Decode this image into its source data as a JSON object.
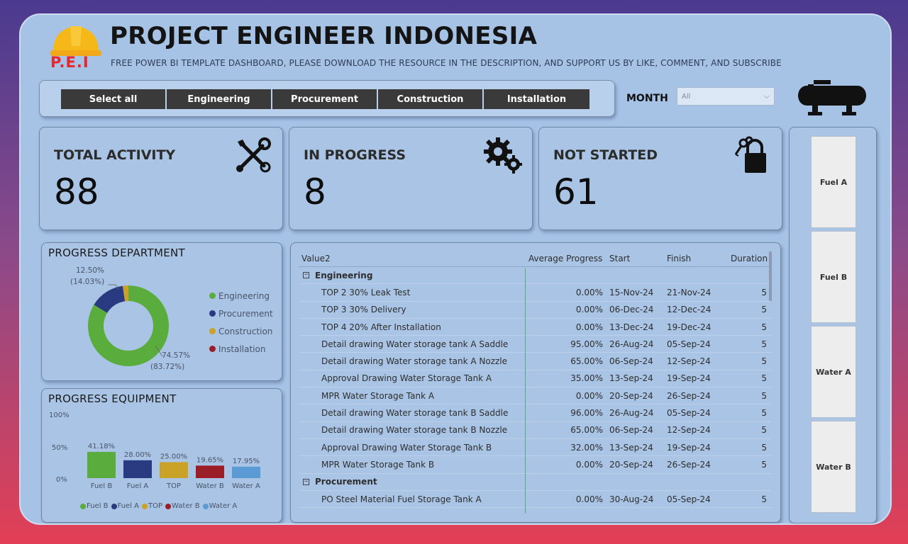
{
  "header": {
    "logo_text": "P.E.I",
    "title": "PROJECT ENGINEER INDONESIA",
    "subtitle": "FREE POWER BI TEMPLATE DASHBOARD, PLEASE DOWNLOAD THE RESOURCE IN THE DESCRIPTION, AND SUPPORT US BY LIKE, COMMENT, AND SUBSCRIBE"
  },
  "slicer": {
    "buttons": [
      "Select all",
      "Engineering",
      "Procurement",
      "Construction",
      "Installation"
    ]
  },
  "month": {
    "label": "MONTH",
    "selected": "All"
  },
  "kpis": [
    {
      "label": "TOTAL ACTIVITY",
      "value": "88",
      "icon": "tools-icon"
    },
    {
      "label": "IN PROGRESS",
      "value": "8",
      "icon": "gears-icon"
    },
    {
      "label": "NOT STARTED",
      "value": "61",
      "icon": "padlock-keys-icon"
    }
  ],
  "progress_department": {
    "title": "PROGRESS DEPARTMENT",
    "label_top_1": "12.50%",
    "label_top_2": "(14.03%)",
    "label_bottom_1": "74.57%",
    "label_bottom_2": "(83.72%)",
    "legend": [
      "Engineering",
      "Procurement",
      "Construction",
      "Installation"
    ]
  },
  "progress_equipment": {
    "title": "PROGRESS EQUIPMENT",
    "y_ticks": [
      "100%",
      "50%",
      "0%"
    ],
    "legend": [
      "Fuel B",
      "Fuel A",
      "TOP",
      "Water B",
      "Water A"
    ]
  },
  "table": {
    "headers": [
      "Value2",
      "Average Progress",
      "Start",
      "Finish",
      "Duration"
    ],
    "groups": [
      {
        "name": "Engineering",
        "rows": [
          [
            "TOP 2 30% Leak Test",
            "0.00%",
            "15-Nov-24",
            "21-Nov-24",
            "5"
          ],
          [
            "TOP 3 30% Delivery",
            "0.00%",
            "06-Dec-24",
            "12-Dec-24",
            "5"
          ],
          [
            "TOP 4 20% After Installation",
            "0.00%",
            "13-Dec-24",
            "19-Dec-24",
            "5"
          ],
          [
            "Detail drawing Water storage tank A Saddle",
            "95.00%",
            "26-Aug-24",
            "05-Sep-24",
            "5"
          ],
          [
            "Detail drawing Water storage tank A Nozzle",
            "65.00%",
            "06-Sep-24",
            "12-Sep-24",
            "5"
          ],
          [
            "Approval Drawing Water Storage Tank A",
            "35.00%",
            "13-Sep-24",
            "19-Sep-24",
            "5"
          ],
          [
            "MPR Water Storage Tank A",
            "0.00%",
            "20-Sep-24",
            "26-Sep-24",
            "5"
          ],
          [
            "Detail drawing Water storage tank B Saddle",
            "96.00%",
            "26-Aug-24",
            "05-Sep-24",
            "5"
          ],
          [
            "Detail drawing Water storage tank B Nozzle",
            "65.00%",
            "06-Sep-24",
            "12-Sep-24",
            "5"
          ],
          [
            "Approval Drawing Water Storage Tank B",
            "32.00%",
            "13-Sep-24",
            "19-Sep-24",
            "5"
          ],
          [
            "MPR Water Storage Tank B",
            "0.00%",
            "20-Sep-24",
            "26-Sep-24",
            "5"
          ]
        ]
      },
      {
        "name": "Procurement",
        "rows": [
          [
            "PO Steel Material Fuel Storage Tank A",
            "0.00%",
            "30-Aug-24",
            "05-Sep-24",
            "5"
          ]
        ]
      }
    ]
  },
  "tanks": [
    "Fuel A",
    "Fuel B",
    "Water A",
    "Water B"
  ],
  "colors": {
    "engineering": "#5aad3c",
    "procurement": "#2a3a80",
    "construction": "#c9a227",
    "installation": "#9b1d27",
    "water_a": "#5b9bd5"
  },
  "chart_data": [
    {
      "type": "pie",
      "title": "PROGRESS DEPARTMENT",
      "categories": [
        "Engineering",
        "Procurement",
        "Construction",
        "Installation"
      ],
      "values": [
        83.72,
        14.03,
        2.25,
        0
      ],
      "colors": [
        "#5aad3c",
        "#2a3a80",
        "#c9a227",
        "#9b1d27"
      ],
      "legend": "right"
    },
    {
      "type": "bar",
      "title": "PROGRESS EQUIPMENT",
      "categories": [
        "Fuel B",
        "Fuel A",
        "TOP",
        "Water B",
        "Water A"
      ],
      "values": [
        41.18,
        28.0,
        25.0,
        19.65,
        17.95
      ],
      "data_labels": [
        "41.18%",
        "28.00%",
        "25.00%",
        "19.65%",
        "17.95%"
      ],
      "colors": [
        "#5aad3c",
        "#2a3a80",
        "#c9a227",
        "#9b1d27",
        "#5b9bd5"
      ],
      "ylim": [
        0,
        100
      ],
      "legend": "bottom"
    }
  ]
}
